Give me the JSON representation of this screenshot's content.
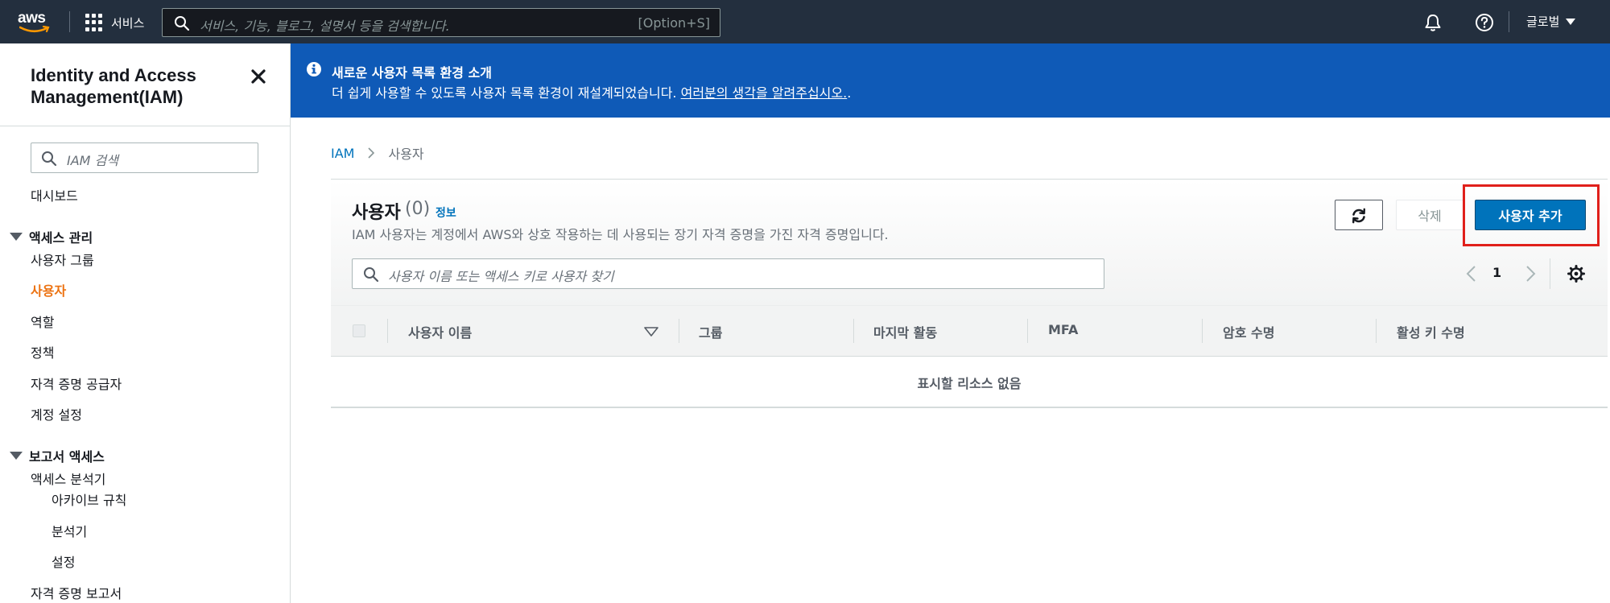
{
  "topnav": {
    "logo_text": "aws",
    "services_label": "서비스",
    "search_placeholder": "서비스, 기능, 블로그, 설명서 등을 검색합니다.",
    "search_shortcut": "[Option+S]",
    "region_label": "글로벌",
    "bg_color": "#232f3e"
  },
  "sidebar": {
    "title": "Identity and Access Management(IAM)",
    "search_placeholder": "IAM 검색",
    "dashboard": "대시보드",
    "sections": [
      {
        "label": "액세스 관리",
        "items": [
          "사용자 그룹",
          "사용자",
          "역할",
          "정책",
          "자격 증명 공급자",
          "계정 설정"
        ],
        "active": "사용자"
      },
      {
        "label": "보고서 액세스",
        "items": [
          "액세스 분석기",
          "아카이브 규칙",
          "분석기",
          "설정",
          "자격 증명 보고서"
        ]
      }
    ],
    "active_color": "#ec7211"
  },
  "banner": {
    "title": "새로운 사용자 목록 환경 소개",
    "text": "더 쉽게 사용할 수 있도록 사용자 목록 환경이 재설계되었습니다. ",
    "link": "여러분의 생각을 알려주십시오.",
    "link_suffix": ".",
    "bg_color": "#0f5ab7"
  },
  "breadcrumb": {
    "root": "IAM",
    "current": "사용자"
  },
  "users_panel": {
    "title": "사용자",
    "count": "(0)",
    "info_label": "정보",
    "description": "IAM 사용자는 계정에서 AWS와 상호 작용하는 데 사용되는 장기 자격 증명을 가진 자격 증명입니다.",
    "delete_label": "삭제",
    "add_user_label": "사용자 추가",
    "filter_placeholder": "사용자 이름 또는 액세스 키로 사용자 찾기",
    "page": "1",
    "columns": [
      "사용자 이름",
      "그룹",
      "마지막 활동",
      "MFA",
      "암호 수명",
      "활성 키 수명"
    ],
    "empty_message": "표시할 리소스 없음",
    "primary_color": "#0073bb",
    "highlight_color": "#e0201b"
  },
  "icons": [
    "search-icon",
    "grid-icon",
    "bell-icon",
    "help-icon",
    "caret-down-icon",
    "close-icon",
    "info-icon",
    "chevron-right-icon",
    "refresh-icon",
    "chevron-left-icon",
    "gear-icon",
    "sort-down-icon"
  ]
}
